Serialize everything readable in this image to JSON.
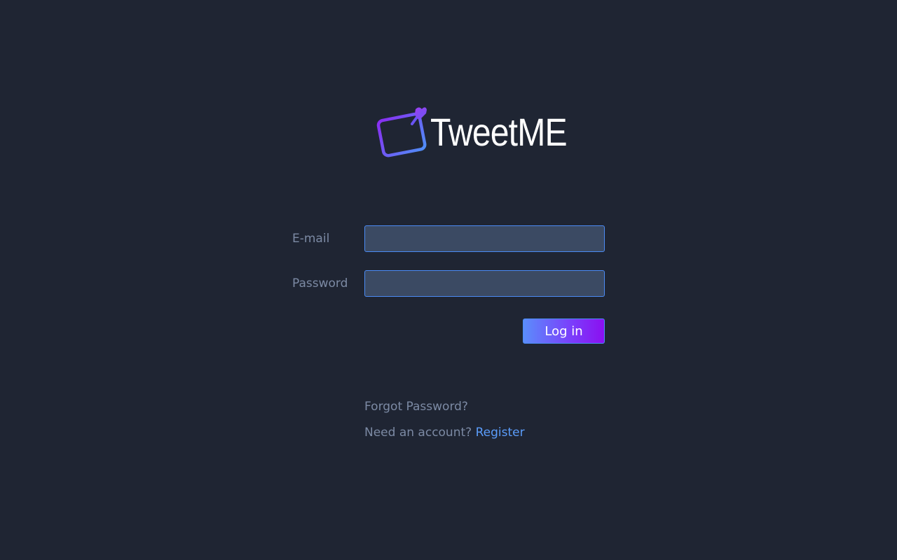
{
  "brand": {
    "name": "TweetME",
    "icon": "pinned-note-icon"
  },
  "form": {
    "email_label": "E-mail",
    "email_value": "",
    "password_label": "Password",
    "password_value": "",
    "login_label": "Log in"
  },
  "links": {
    "forgot_password": "Forgot Password?",
    "need_account": "Need an account?",
    "register": "Register"
  },
  "colors": {
    "background": "#1f2533",
    "input_bg": "#3b4a63",
    "accent_blue": "#5b9dfb",
    "accent_purple": "#8b10f0",
    "muted_text": "#7c8aa4"
  }
}
